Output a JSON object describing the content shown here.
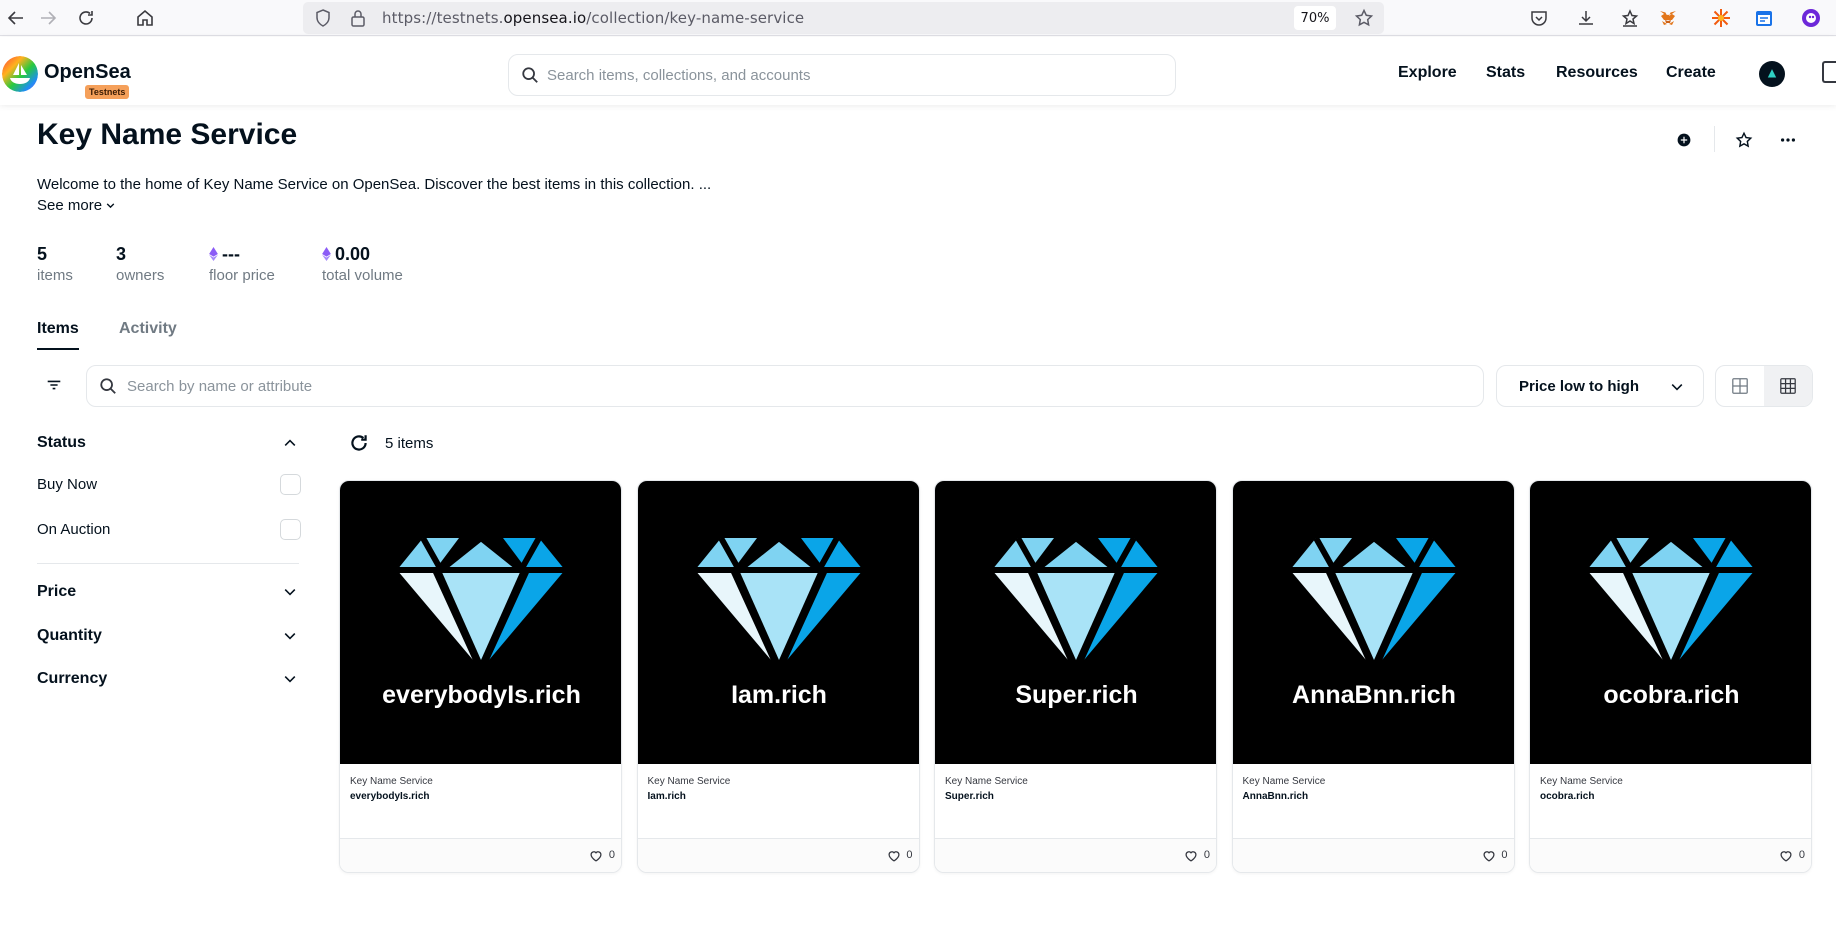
{
  "browser": {
    "url_prefix": "https://testnets.",
    "url_host": "opensea.io",
    "url_path": "/collection/key-name-service",
    "zoom": "70%"
  },
  "header": {
    "logo_text": "OpenSea",
    "badge": "Testnets",
    "search_placeholder": "Search items, collections, and accounts",
    "nav": [
      "Explore",
      "Stats",
      "Resources",
      "Create"
    ]
  },
  "collection": {
    "title": "Key Name Service",
    "description": "Welcome to the home of Key Name Service on OpenSea. Discover the best items in this collection. ...",
    "see_more": "See more",
    "stats": [
      {
        "value": "5",
        "label": "items"
      },
      {
        "value": "3",
        "label": "owners"
      },
      {
        "value": "---",
        "label": "floor price"
      },
      {
        "value": "0.00",
        "label": "total volume"
      }
    ]
  },
  "tabs": [
    "Items",
    "Activity"
  ],
  "toolbar": {
    "search_placeholder": "Search by name or attribute",
    "sort_label": "Price low to high"
  },
  "sidebar": {
    "status_title": "Status",
    "status_options": [
      "Buy Now",
      "On Auction"
    ],
    "price_title": "Price",
    "quantity_title": "Quantity",
    "currency_title": "Currency"
  },
  "results": {
    "count": "5 items",
    "items": [
      {
        "image_text": "everybodyIs.rich",
        "collection": "Key Name Service",
        "name": "everybodyIs.rich",
        "likes": "0"
      },
      {
        "image_text": "Iam.rich",
        "collection": "Key Name Service",
        "name": "Iam.rich",
        "likes": "0"
      },
      {
        "image_text": "Super.rich",
        "collection": "Key Name Service",
        "name": "Super.rich",
        "likes": "0"
      },
      {
        "image_text": "AnnaBnn.rich",
        "collection": "Key Name Service",
        "name": "AnnaBnn.rich",
        "likes": "0"
      },
      {
        "image_text": "ocobra.rich",
        "collection": "Key Name Service",
        "name": "ocobra.rich",
        "likes": "0"
      }
    ]
  },
  "colors": {
    "diamond_light": "#e8f6fb",
    "diamond_mid": "#a9e3f7",
    "diamond_top": "#7fd3f2",
    "diamond_accent": "#0aa5e8",
    "eth_purple": "#8b5cf6",
    "badge": "#f5a05a"
  }
}
